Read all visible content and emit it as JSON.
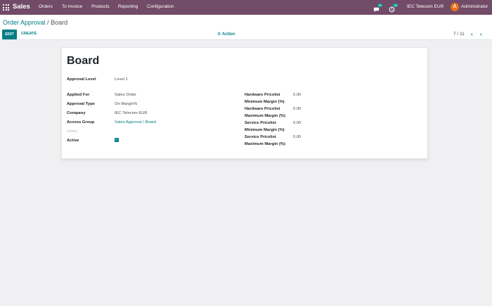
{
  "navbar": {
    "brand": "Sales",
    "menu": [
      "Orders",
      "To Invoice",
      "Products",
      "Reporting",
      "Configuration"
    ],
    "messages_count": "30",
    "activities_count": "38",
    "company": "IEC Telecom EUR",
    "avatar_letter": "A",
    "user": "Administrator"
  },
  "control_panel": {
    "breadcrumb_parent": "Order Approval",
    "breadcrumb_sep": "/",
    "breadcrumb_current": "Board",
    "edit_label": "EDIT",
    "create_label": "CREATE",
    "action_label": "Action",
    "pager": "7 / 11"
  },
  "form": {
    "title": "Board",
    "approval_level_label": "Approval Level",
    "approval_level_value": "Level 1",
    "applied_for_label": "Applied For",
    "applied_for_value": "Sales Order",
    "approval_type_label": "Approval Type",
    "approval_type_value": "On Margin%",
    "company_label": "Company",
    "company_value": "IEC Telecom EUR",
    "access_group_label": "Access Group",
    "access_group_value": "Sales Approval / Board",
    "users_label": "Users",
    "active_label": "Active",
    "active_value": true,
    "hw_min_label_1": "Hardware Pricelist",
    "hw_min_label_2": "Minimum Margin (%)",
    "hw_min_value": "0.00",
    "hw_max_label_1": "Hardware Pricelist",
    "hw_max_label_2": "Maximum Margin (%)",
    "hw_max_value": "0.00",
    "sv_min_label_1": "Service Pricelist",
    "sv_min_label_2": "Minimum Margin (%)",
    "sv_min_value": "0.00",
    "sv_max_label_1": "Service Pricelist",
    "sv_max_label_2": "Maximum Margin (%)",
    "sv_max_value": "0.00"
  },
  "colors": {
    "navbar": "#714b67",
    "accent": "#017e84",
    "badge": "#00a09d",
    "avatar": "#e8721c"
  }
}
